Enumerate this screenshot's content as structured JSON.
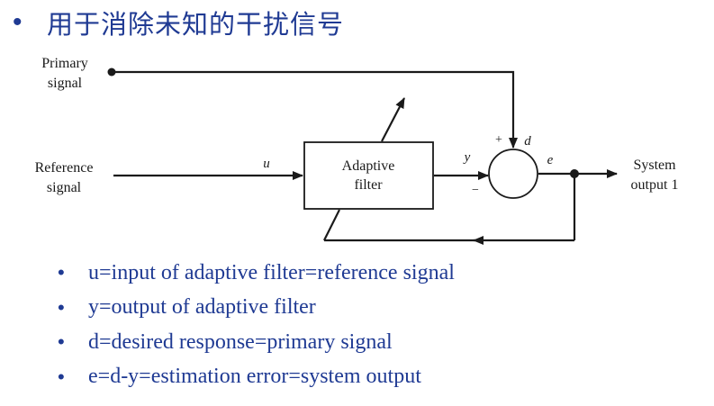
{
  "title": {
    "bullet": "•",
    "text": "用于消除未知的干扰信号"
  },
  "diagram": {
    "primary_label": [
      "Primary",
      "signal"
    ],
    "reference_label": [
      "Reference",
      "signal"
    ],
    "filter_label": [
      "Adaptive",
      "filter"
    ],
    "output_label": [
      "System",
      "output 1"
    ],
    "u": "u",
    "y": "y",
    "d": "d",
    "e": "e",
    "plus": "+",
    "minus": "−"
  },
  "bullets": [
    {
      "dot": "•",
      "text": "u=input of adaptive filter=reference signal"
    },
    {
      "dot": "•",
      "text": "y=output of adaptive filter"
    },
    {
      "dot": "•",
      "text": "d=desired response=primary signal"
    },
    {
      "dot": "•",
      "text": "e=d-y=estimation error=system output"
    }
  ],
  "colors": {
    "accent": "#1f3a93",
    "ink": "#1a1a1a"
  }
}
